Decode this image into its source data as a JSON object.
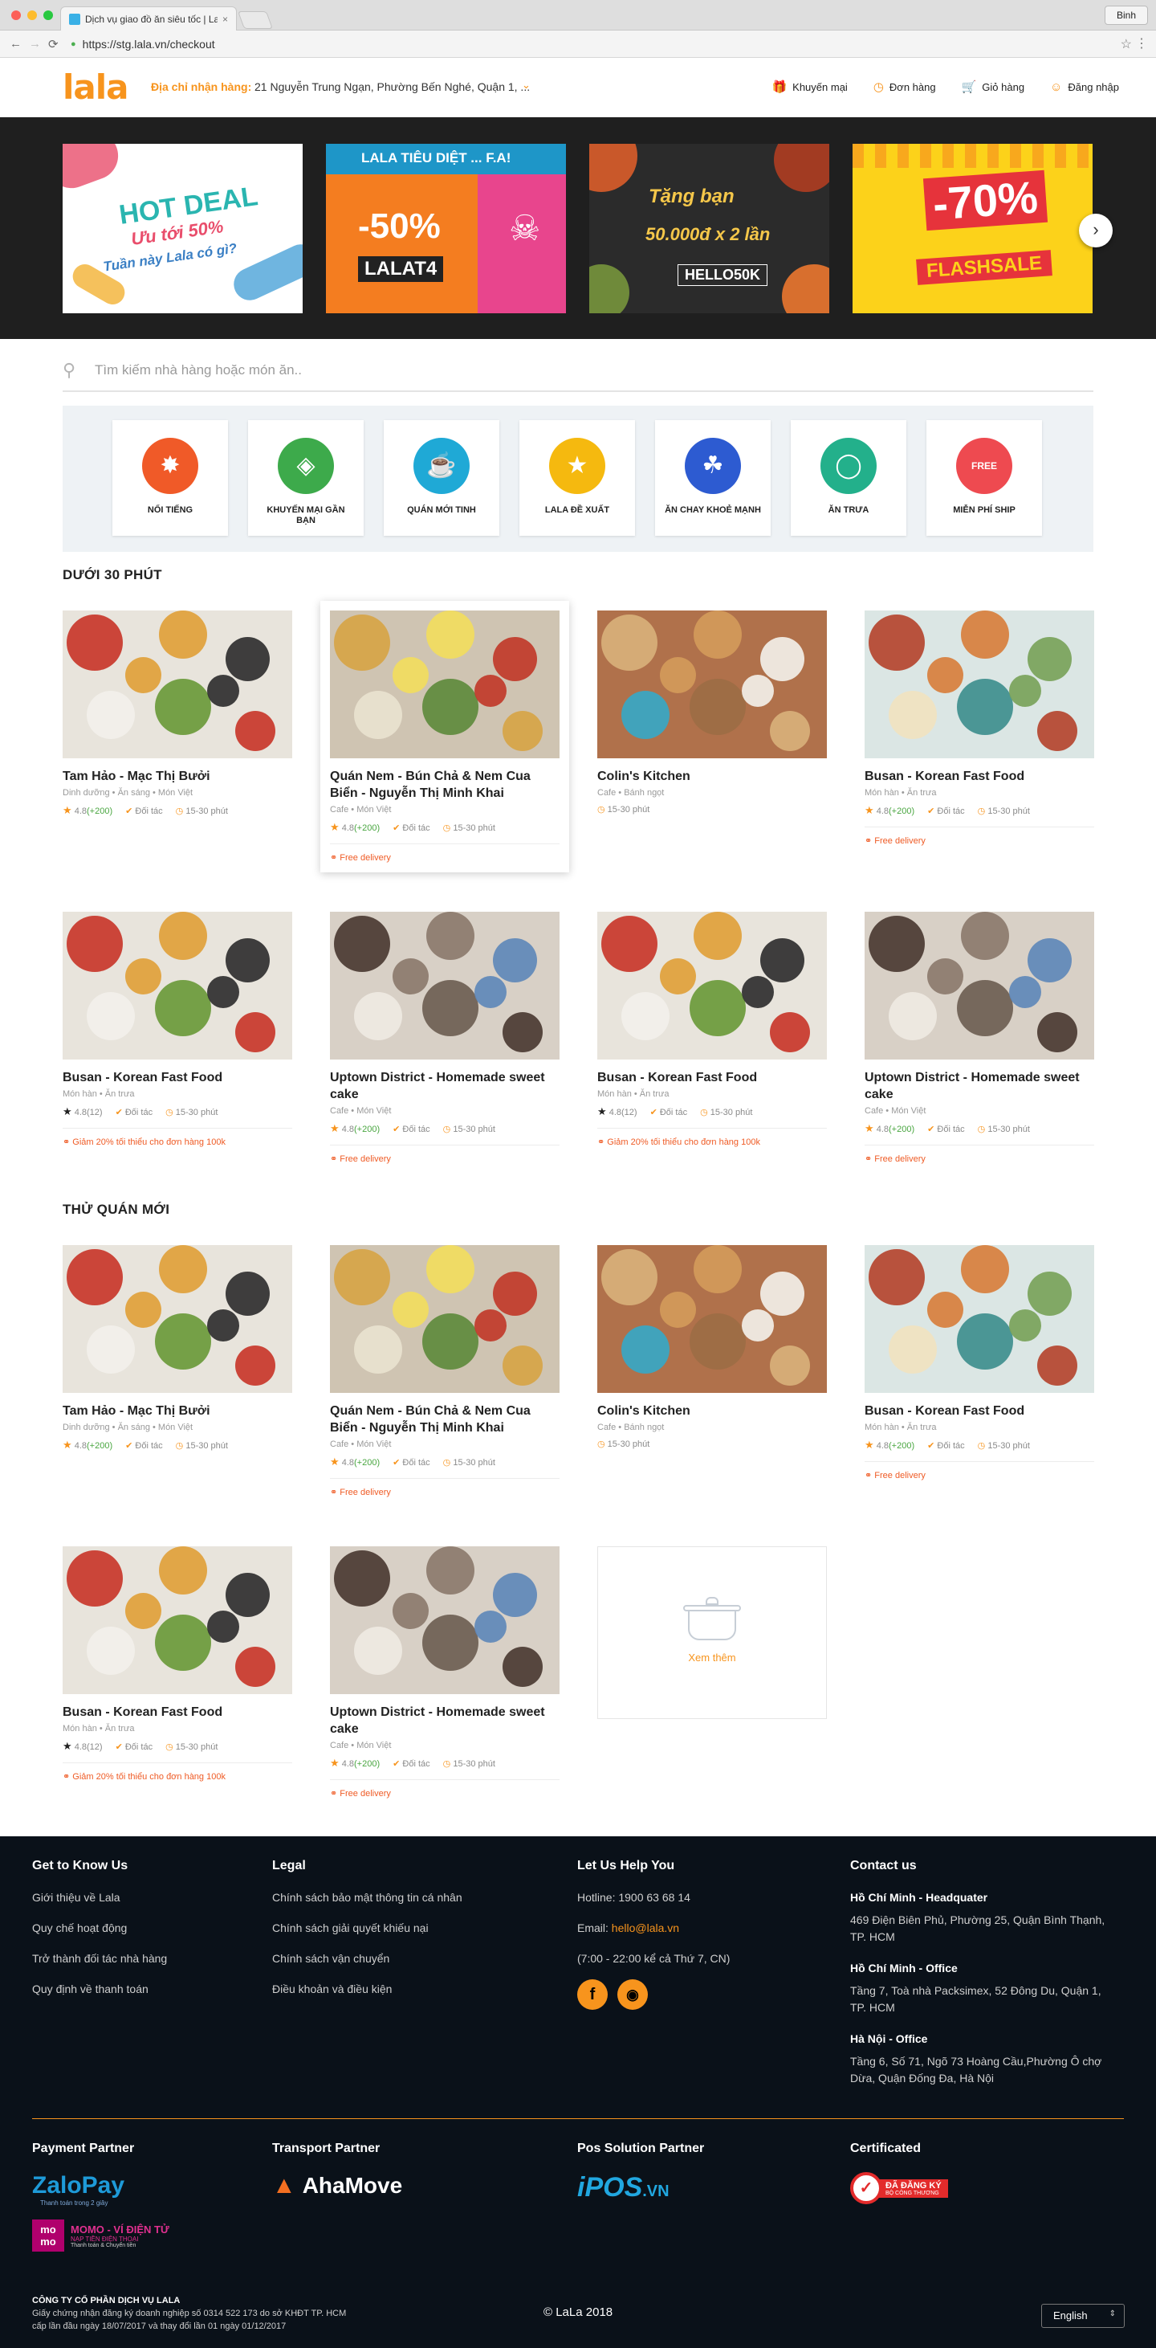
{
  "browser": {
    "tab_title": "Dịch vụ giao đồ ăn siêu tốc | LaLa",
    "url": "https://stg.lala.vn/checkout",
    "profile": "Binh",
    "back": "←",
    "forward": "→",
    "reload": "⟳",
    "star": "☆",
    "menu": "⋮",
    "close": "×"
  },
  "header": {
    "logo": "lala",
    "address_label": "Địa chỉ nhận hàng:",
    "address_value": "21 Nguyễn Trung Ngạn, Phường Bến Nghé, Quận 1, ...",
    "nav": [
      "Khuyến mại",
      "Đơn hàng",
      "Giỏ hàng",
      "Đăng nhập"
    ]
  },
  "banners": [
    {
      "line1": "HOT DEAL",
      "line2": "Ưu tới 50%",
      "line3": "Tuần này Lala có gì?"
    },
    {
      "line1": "LALA TIÊU DIỆT ... F.A!",
      "line2": "-50%",
      "line3": "LALAT4"
    },
    {
      "line1": "Tặng bạn",
      "line2": "50.000đ x 2 lần",
      "line3": "HELLO50K"
    },
    {
      "line1": "-70%",
      "line2": "FLASHSALE"
    }
  ],
  "search": {
    "placeholder": "Tìm kiếm nhà hàng hoặc món ăn..",
    "icon": "search-icon"
  },
  "categories": [
    {
      "label": "NỔI TIẾNG",
      "color": "#f05a28"
    },
    {
      "label": "KHUYẾN MẠI GẦN BẠN",
      "color": "#3daa4b"
    },
    {
      "label": "QUÁN MỚI TINH",
      "color": "#1fa9d6"
    },
    {
      "label": "LALA ĐỀ XUẤT",
      "color": "#f5b90f"
    },
    {
      "label": "ĂN CHAY KHOẺ MẠNH",
      "color": "#2d5bd1"
    },
    {
      "label": "ĂN TRƯA",
      "color": "#23b08b"
    },
    {
      "label": "MIỄN PHÍ SHIP",
      "color": "#ee4a50"
    }
  ],
  "sections": [
    {
      "title": "DƯỚI 30 PHÚT"
    },
    {
      "title": "THỬ QUÁN MỚI"
    }
  ],
  "cards": [
    {
      "title": "Tam Hảo - Mạc Thị Bưởi",
      "sub": "Dinh dưỡng • Ăn sáng • Món Việt",
      "rating": "4.8",
      "count": "(+200)",
      "partner": "Đối tác",
      "time": "15-30 phút",
      "promo": ""
    },
    {
      "title": "Quán Nem - Bún Chả & Nem Cua Biển - Nguyễn Thị Minh Khai",
      "sub": "Cafe • Món Việt",
      "rating": "4.8",
      "count": "(+200)",
      "partner": "Đối tác",
      "time": "15-30 phút",
      "promo": "Free delivery"
    },
    {
      "title": "Colin's Kitchen",
      "sub": "Cafe • Bánh ngọt",
      "rating": "",
      "count": "",
      "partner": "",
      "time": "15-30 phút",
      "promo": ""
    },
    {
      "title": "Busan - Korean Fast Food",
      "sub": "Món hàn • Ăn trưa",
      "rating": "4.8",
      "count": "(+200)",
      "partner": "Đối tác",
      "time": "15-30 phút",
      "promo": "Free delivery"
    },
    {
      "title": "Busan - Korean Fast Food",
      "sub": "Món hàn • Ăn trưa",
      "rating": "4.8",
      "count": "(12)",
      "partner": "Đối tác",
      "time": "15-30 phút",
      "promo": "Giảm 20% tối thiểu cho đơn hàng 100k"
    },
    {
      "title": "Uptown District - Homemade sweet cake",
      "sub": "Cafe • Món Việt",
      "rating": "4.8",
      "count": "(+200)",
      "partner": "Đối tác",
      "time": "15-30 phút",
      "promo": "Free delivery"
    },
    {
      "title": "Busan - Korean Fast Food",
      "sub": "Món hàn • Ăn trưa",
      "rating": "4.8",
      "count": "(12)",
      "partner": "Đối tác",
      "time": "15-30 phút",
      "promo": "Giảm 20% tối thiểu cho đơn hàng 100k"
    },
    {
      "title": "Uptown District - Homemade sweet cake",
      "sub": "Cafe • Món Việt",
      "rating": "4.8",
      "count": "(+200)",
      "partner": "Đối tác",
      "time": "15-30 phút",
      "promo": "Free delivery"
    },
    {
      "title": "Tam Hảo - Mạc Thị Bưởi",
      "sub": "Dinh dưỡng • Ăn sáng • Món Việt",
      "rating": "4.8",
      "count": "(+200)",
      "partner": "Đối tác",
      "time": "15-30 phút",
      "promo": ""
    },
    {
      "title": "Quán Nem - Bún Chả & Nem Cua Biển - Nguyễn Thị Minh Khai",
      "sub": "Cafe • Món Việt",
      "rating": "4.8",
      "count": "(+200)",
      "partner": "Đối tác",
      "time": "15-30 phút",
      "promo": "Free delivery"
    },
    {
      "title": "Colin's Kitchen",
      "sub": "Cafe • Bánh ngọt",
      "rating": "",
      "count": "",
      "partner": "",
      "time": "15-30 phút",
      "promo": ""
    },
    {
      "title": "Busan - Korean Fast Food",
      "sub": "Món hàn • Ăn trưa",
      "rating": "4.8",
      "count": "(+200)",
      "partner": "Đối tác",
      "time": "15-30 phút",
      "promo": "Free delivery"
    },
    {
      "title": "Busan - Korean Fast Food",
      "sub": "Món hàn • Ăn trưa",
      "rating": "4.8",
      "count": "(12)",
      "partner": "Đối tác",
      "time": "15-30 phút",
      "promo": "Giảm 20% tối thiểu cho đơn hàng 100k"
    },
    {
      "title": "Uptown District - Homemade sweet cake",
      "sub": "Cafe • Món Việt",
      "rating": "4.8",
      "count": "(+200)",
      "partner": "Đối tác",
      "time": "15-30 phút",
      "promo": "Free delivery"
    }
  ],
  "see_more": "Xem thêm",
  "footer": {
    "col1": {
      "title": "Get to Know Us",
      "links": [
        "Giới thiệu về Lala",
        "Quy chế hoạt động",
        "Trở thành đối tác nhà hàng",
        "Quy định về thanh toán"
      ]
    },
    "col2": {
      "title": "Legal",
      "links": [
        "Chính sách bảo mật thông tin cá nhân",
        "Chính sách giải quyết khiếu nại",
        "Chính sách vận chuyển",
        "Điều khoản và điều kiện"
      ]
    },
    "col3": {
      "title": "Let Us Help You",
      "hotline": "Hotline: 1900 63 68 14",
      "email_label": "Email:",
      "email": "hello@lala.vn",
      "hours": "(7:00 - 22:00 kể cả Thứ 7, CN)"
    },
    "col4": {
      "title": "Contact us",
      "offices": [
        {
          "name": "Hồ Chí Minh - Headquater",
          "addr": "469 Điện Biên Phủ, Phường 25, Quận Bình Thạnh, TP. HCM"
        },
        {
          "name": "Hồ Chí Minh - Office",
          "addr": "Tầng 7, Toà nhà Packsimex, 52 Đông Du, Quận 1, TP. HCM"
        },
        {
          "name": "Hà Nội - Office",
          "addr": "Tầng 6, Số 71, Ngõ 73 Hoàng Cầu,Phường Ô chợ Dừa, Quận Đống Đa, Hà Nội"
        }
      ]
    },
    "partners": {
      "payment": "Payment Partner",
      "zalo": "ZaloPay",
      "zalo_sub": "Thanh toán trong 2 giây",
      "momo": "MOMO - VÍ ĐIỆN TỬ",
      "momo_sub1": "NẠP TIỀN ĐIỆN THOẠI",
      "momo_sub2": "Thanh toán & Chuyển tiền",
      "momo_logo": "mo mo",
      "transport": "Transport Partner",
      "ahamove": "AhaMove",
      "pos": "Pos Solution Partner",
      "ipos": "iPOS",
      "ipos_vn": ".VN",
      "cert": "Certificated",
      "cert_text": "ĐÃ ĐĂNG KÝ",
      "cert_sub": "BỘ CÔNG THƯƠNG"
    },
    "legal_company": "CÔNG TY CỔ PHẦN DỊCH VỤ LALA",
    "legal_line1": "Giấy chứng nhận đăng ký doanh nghiệp số 0314 522 173 do sở KHĐT TP. HCM",
    "legal_line2": "cấp lần đầu ngày 18/07/2017 và thay đổi lần 01 ngày 01/12/2017",
    "copyright": "© LaLa 2018",
    "language": "English"
  }
}
